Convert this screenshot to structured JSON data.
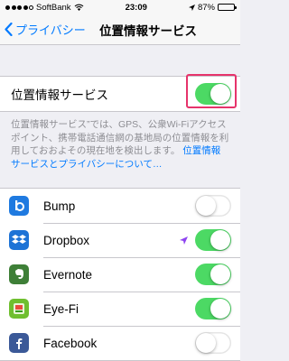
{
  "status_bar": {
    "carrier": "SoftBank",
    "time": "23:09",
    "battery_percent": "87%",
    "battery_level": 0.87
  },
  "nav": {
    "back_label": "プライバシー",
    "title": "位置情報サービス"
  },
  "location_services": {
    "label": "位置情報サービス",
    "enabled": true
  },
  "footnote": {
    "text": "位置情報サービス”では、GPS、公衆Wi-Fiアクセスポイント、携帯電話通信網の基地局の位置情報を利用しておおよその現在地を検出します。",
    "link": "位置情報サービスとプライバシーについて…"
  },
  "apps": [
    {
      "name": "Bump",
      "icon": "bump-icon",
      "enabled": false,
      "location_arrow": false
    },
    {
      "name": "Dropbox",
      "icon": "dropbox-icon",
      "enabled": true,
      "location_arrow": true
    },
    {
      "name": "Evernote",
      "icon": "evernote-icon",
      "enabled": true,
      "location_arrow": false
    },
    {
      "name": "Eye-Fi",
      "icon": "eye-fi-icon",
      "enabled": true,
      "location_arrow": false
    },
    {
      "name": "Facebook",
      "icon": "facebook-icon",
      "enabled": false,
      "location_arrow": false
    }
  ],
  "colors": {
    "accent": "#007aff",
    "toggle_on": "#4cd964",
    "highlight": "#e6336b",
    "location_arrow": "#8e44f0"
  }
}
